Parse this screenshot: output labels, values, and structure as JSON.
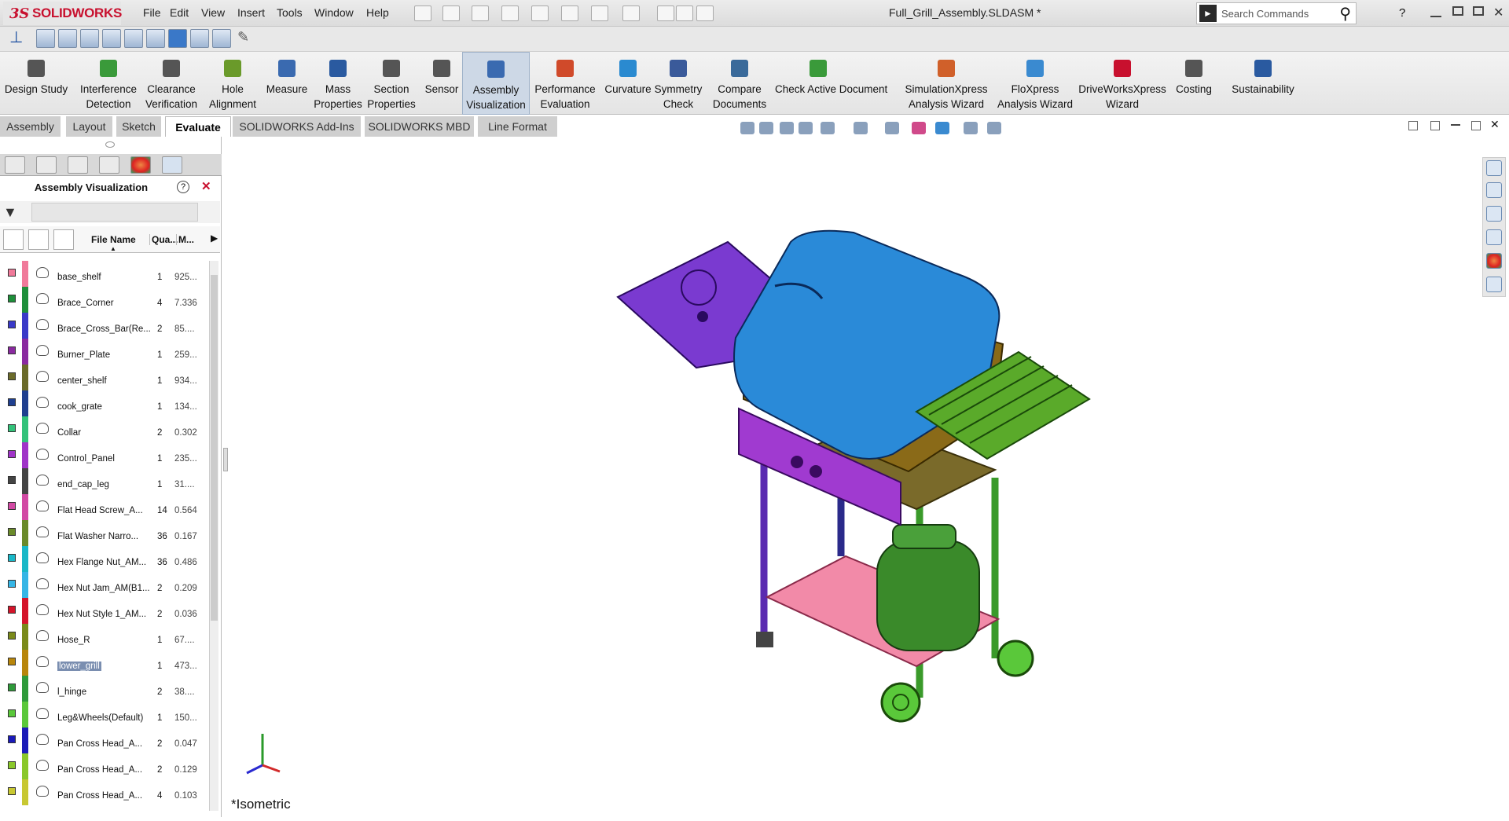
{
  "app": {
    "brand": "SOLIDWORKS",
    "document_title": "Full_Grill_Assembly.SLDASM *"
  },
  "menu": [
    "File",
    "Edit",
    "View",
    "Insert",
    "Tools",
    "Window",
    "Help"
  ],
  "search": {
    "placeholder": "Search Commands",
    "help": "?"
  },
  "ribbon": [
    {
      "label": "Design Study",
      "icon": "design-study-icon"
    },
    {
      "label": "Interference\nDetection",
      "icon": "interference-icon"
    },
    {
      "label": "Clearance\nVerification",
      "icon": "clearance-icon"
    },
    {
      "label": "Hole\nAlignment",
      "icon": "hole-alignment-icon"
    },
    {
      "label": "Measure",
      "icon": "measure-icon"
    },
    {
      "label": "Mass\nProperties",
      "icon": "mass-properties-icon"
    },
    {
      "label": "Section\nProperties",
      "icon": "section-properties-icon"
    },
    {
      "label": "Sensor",
      "icon": "sensor-icon"
    },
    {
      "label": "Assembly\nVisualization",
      "icon": "assembly-visualization-icon",
      "selected": true
    },
    {
      "label": "Performance\nEvaluation",
      "icon": "performance-icon"
    },
    {
      "label": "Curvature",
      "icon": "curvature-icon"
    },
    {
      "label": "Symmetry\nCheck",
      "icon": "symmetry-icon"
    },
    {
      "label": "Compare\nDocuments",
      "icon": "compare-icon"
    },
    {
      "label": "Check Active Document",
      "icon": "check-document-icon"
    },
    {
      "label": "SimulationXpress\nAnalysis Wizard",
      "icon": "simulationxpress-icon"
    },
    {
      "label": "FloXpress\nAnalysis Wizard",
      "icon": "floxpress-icon"
    },
    {
      "label": "DriveWorksXpress\nWizard",
      "icon": "driveworks-icon"
    },
    {
      "label": "Costing",
      "icon": "costing-icon"
    },
    {
      "label": "Sustainability",
      "icon": "sustainability-icon"
    }
  ],
  "tabs": [
    "Assembly",
    "Layout",
    "Sketch",
    "Evaluate",
    "SOLIDWORKS Add-Ins",
    "SOLIDWORKS MBD",
    "Line Format"
  ],
  "active_tab": "Evaluate",
  "panel": {
    "title": "Assembly Visualization",
    "columns": {
      "name": "File Name",
      "qty": "Qua...",
      "mass": "M..."
    },
    "rows": [
      {
        "name": "base_shelf",
        "qty": "1",
        "mass": "925...",
        "color": "#f07a9a",
        "hl": false
      },
      {
        "name": "Brace_Corner",
        "qty": "4",
        "mass": "7.336",
        "color": "#1e8f3a"
      },
      {
        "name": "Brace_Cross_Bar(Re...",
        "qty": "2",
        "mass": "85....",
        "color": "#3a3ac8"
      },
      {
        "name": "Burner_Plate",
        "qty": "1",
        "mass": "259...",
        "color": "#8a2aa0"
      },
      {
        "name": "center_shelf",
        "qty": "1",
        "mass": "934...",
        "color": "#6b6b2a"
      },
      {
        "name": "cook_grate",
        "qty": "1",
        "mass": "134...",
        "color": "#1f3f8f"
      },
      {
        "name": "Collar",
        "qty": "2",
        "mass": "0.302",
        "color": "#33c27a"
      },
      {
        "name": "Control_Panel",
        "qty": "1",
        "mass": "235...",
        "color": "#a034c8"
      },
      {
        "name": "end_cap_leg",
        "qty": "1",
        "mass": "31....",
        "color": "#444444"
      },
      {
        "name": "Flat Head Screw_A...",
        "qty": "14",
        "mass": "0.564",
        "color": "#d24aa4"
      },
      {
        "name": "Flat Washer Narro...",
        "qty": "36",
        "mass": "0.167",
        "color": "#6a8a2a"
      },
      {
        "name": "Hex Flange Nut_AM...",
        "qty": "36",
        "mass": "0.486",
        "color": "#19b8c8"
      },
      {
        "name": "Hex Nut Jam_AM(B1...",
        "qty": "2",
        "mass": "0.209",
        "color": "#36b6e6"
      },
      {
        "name": "Hex Nut Style 1_AM...",
        "qty": "2",
        "mass": "0.036",
        "color": "#d4142a"
      },
      {
        "name": "Hose_R",
        "qty": "1",
        "mass": "67....",
        "color": "#7a8a1a"
      },
      {
        "name": "lower_grill",
        "qty": "1",
        "mass": "473...",
        "color": "#b8860b",
        "hl": true
      },
      {
        "name": "l_hinge",
        "qty": "2",
        "mass": "38....",
        "color": "#2f9a3a"
      },
      {
        "name": "Leg&Wheels(Default)",
        "qty": "1",
        "mass": "150...",
        "color": "#5ac83a"
      },
      {
        "name": "Pan Cross Head_A...",
        "qty": "2",
        "mass": "0.047",
        "color": "#1a1ab8"
      },
      {
        "name": "Pan Cross Head_A...",
        "qty": "2",
        "mass": "0.129",
        "color": "#8ac82a"
      },
      {
        "name": "Pan Cross Head_A...",
        "qty": "4",
        "mass": "0.103",
        "color": "#c8c832"
      }
    ]
  },
  "viewport": {
    "view_label": "*Isometric"
  },
  "colors": {
    "accent": "#c8102e",
    "selected_ribbon": "#cdd8e6"
  }
}
